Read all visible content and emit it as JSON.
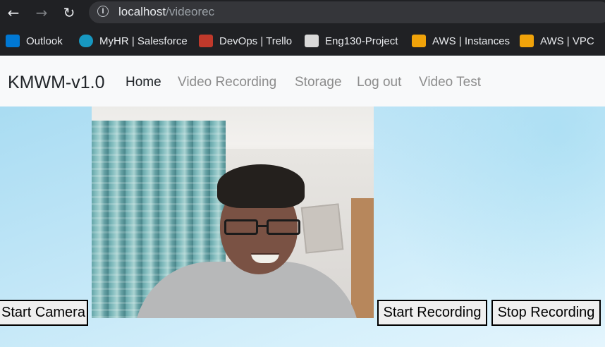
{
  "browser": {
    "url_host": "localhost",
    "url_path": "/videorec",
    "back_glyph": "←",
    "forward_glyph": "→",
    "reload_glyph": "↻",
    "info_glyph": "i",
    "bookmarks": [
      {
        "label": "Outlook",
        "icon": "outlook-icon",
        "color": "#0078d4"
      },
      {
        "label": "MyHR | Salesforce",
        "icon": "salesforce-cloud-icon",
        "color": "#1798c1"
      },
      {
        "label": "DevOps | Trello",
        "icon": "trello-icon",
        "color": "#c0392b"
      },
      {
        "label": "Eng130-Project",
        "icon": "project-icon",
        "color": "#d9d9d9"
      },
      {
        "label": "AWS | Instances",
        "icon": "aws-box-icon",
        "color": "#f0a30a"
      },
      {
        "label": "AWS | VPC",
        "icon": "aws-box-icon",
        "color": "#f0a30a"
      }
    ]
  },
  "navbar": {
    "brand": "KMWM-v1.0",
    "links": [
      {
        "label": "Home",
        "active": true
      },
      {
        "label": "Video Recording",
        "active": false
      },
      {
        "label": "Storage",
        "active": false
      },
      {
        "label": "Log out",
        "active": false
      },
      {
        "label": "Video Test",
        "active": false
      }
    ]
  },
  "controls": {
    "start_camera": "Start Camera",
    "start_recording": "Start Recording",
    "stop_recording": "Stop Recording"
  }
}
